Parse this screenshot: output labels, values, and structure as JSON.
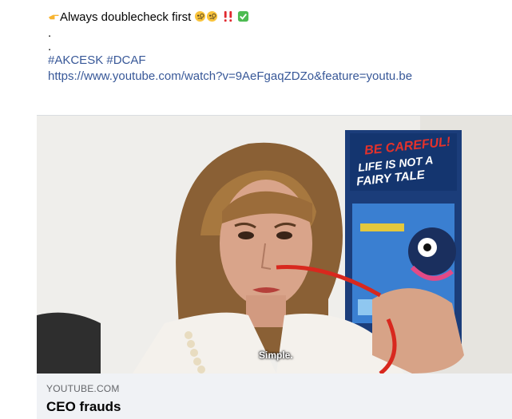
{
  "post": {
    "line1_text": "Always doublecheck first",
    "line1_emojis": [
      "pointing-right-emoji",
      "monocle-face-emoji",
      "monocle-face-emoji",
      "double-exclamation-emoji",
      "check-mark-button-emoji"
    ],
    "dot1": ".",
    "dot2": ".",
    "hashtags": "#AKCESK #DCAF",
    "url": "https://www.youtube.com/watch?v=9AeFgaqZDZo&feature=youtu.be"
  },
  "attachment": {
    "domain": "YOUTUBE.COM",
    "title": "CEO frauds",
    "caption": "Simple.",
    "poster_line1": "BE CAREFUL!",
    "poster_line2": "LIFE IS NOT A",
    "poster_line3": "FAIRY TALE"
  },
  "colors": {
    "link": "#385898",
    "meta_bg": "#f0f2f5",
    "poster_red": "#e4322b"
  }
}
